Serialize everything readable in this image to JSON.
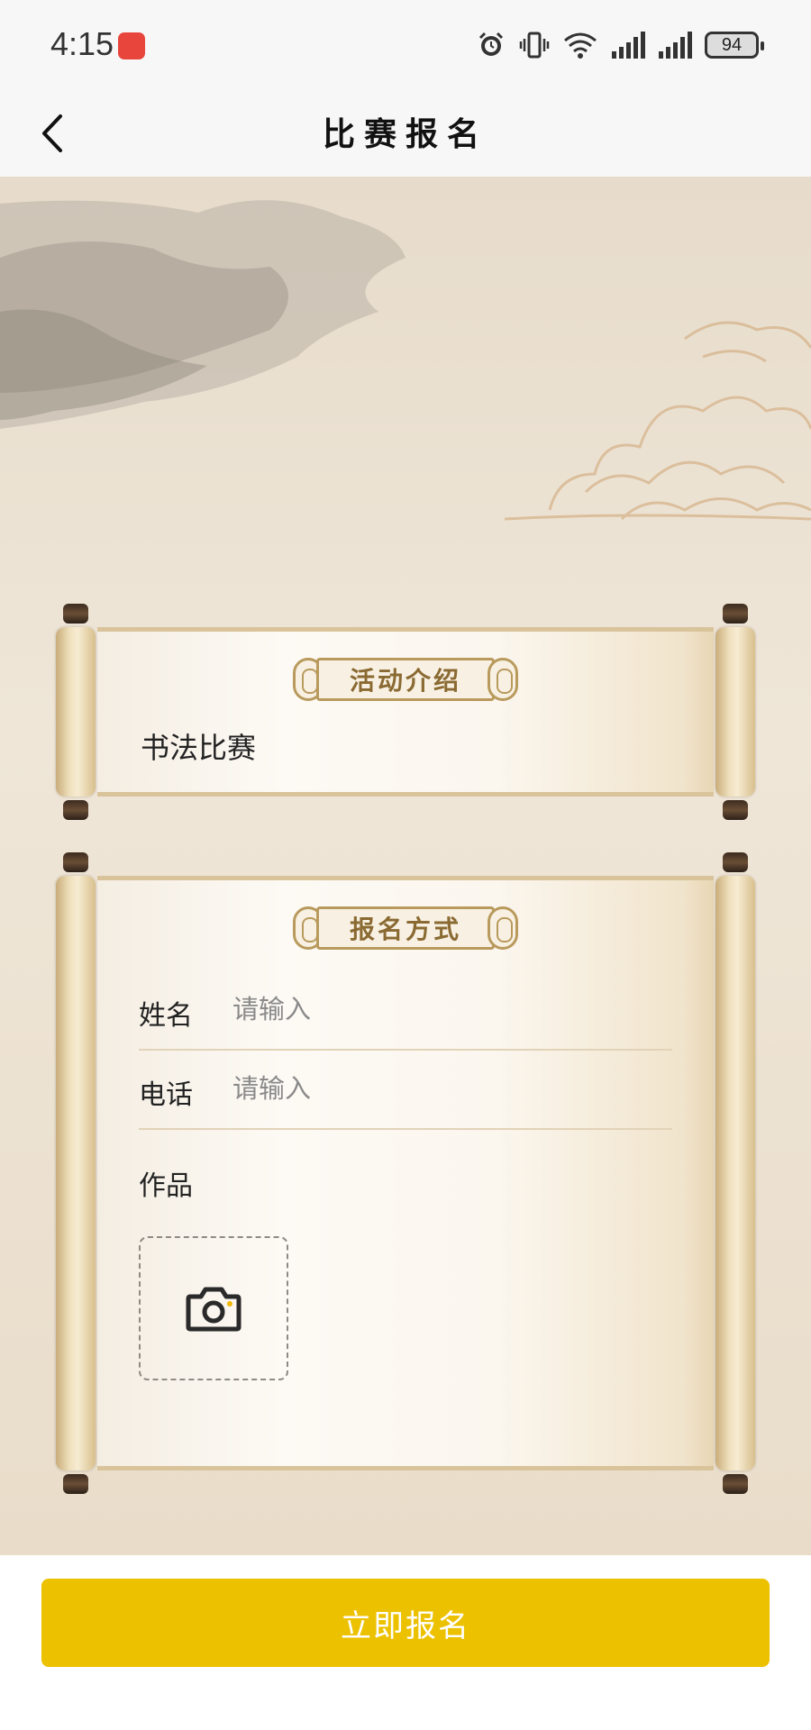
{
  "status_bar": {
    "time": "4:15",
    "battery": "94",
    "icons": [
      "app-notification-icon",
      "alarm-icon",
      "vibrate-icon",
      "wifi-icon",
      "signal-icon",
      "signal-icon",
      "battery-icon"
    ]
  },
  "nav": {
    "title": "比赛报名",
    "back_icon": "chevron-left-icon"
  },
  "intro_section": {
    "title": "活动介绍",
    "text": "书法比赛"
  },
  "signup_section": {
    "title": "报名方式",
    "fields": [
      {
        "label": "姓名",
        "placeholder": "请输入",
        "value": ""
      },
      {
        "label": "电话",
        "placeholder": "请输入",
        "value": ""
      }
    ],
    "works_label": "作品",
    "upload_icon": "camera-icon"
  },
  "submit_label": "立即报名",
  "colors": {
    "accent": "#ECC100",
    "parchment": "#EBE0CF",
    "scroll_trim": "#B99A5D"
  }
}
